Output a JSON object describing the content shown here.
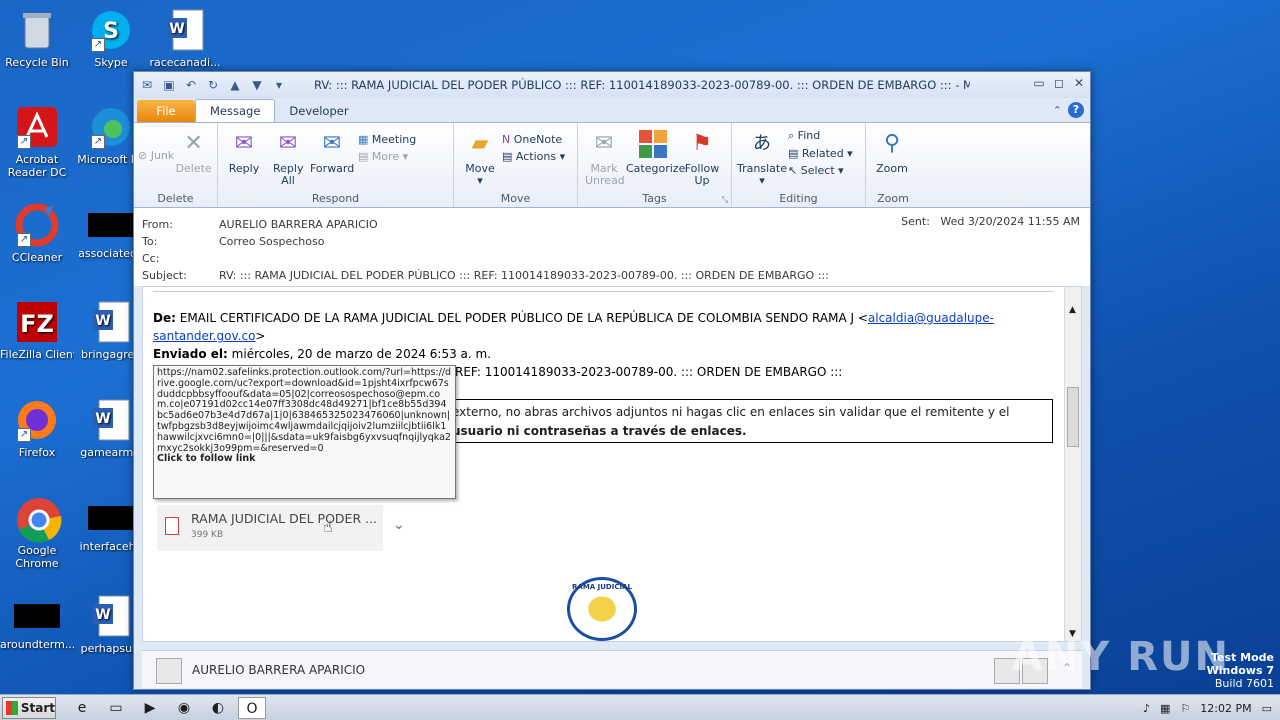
{
  "desktop": {
    "icons": [
      {
        "label": "Recycle Bin",
        "icon": "recycle-bin-icon"
      },
      {
        "label": "Skype",
        "icon": "skype-icon"
      },
      {
        "label": "racecanadi...",
        "icon": "word-doc-icon"
      },
      {
        "label": "Acrobat Reader DC",
        "icon": "acrobat-icon"
      },
      {
        "label": "Microsoft Ed",
        "icon": "edge-icon"
      },
      {
        "label": "CCleaner",
        "icon": "ccleaner-icon"
      },
      {
        "label": "associatede",
        "icon": "black-file-icon"
      },
      {
        "label": "FileZilla Client",
        "icon": "filezilla-icon"
      },
      {
        "label": "bringagree",
        "icon": "word-doc-icon"
      },
      {
        "label": "Firefox",
        "icon": "firefox-icon"
      },
      {
        "label": "gamearmy.",
        "icon": "word-doc-icon"
      },
      {
        "label": "Google Chrome",
        "icon": "chrome-icon"
      },
      {
        "label": "interfaceha",
        "icon": "black-file-icon"
      },
      {
        "label": "aroundterm...",
        "icon": "black-file-icon"
      },
      {
        "label": "perhapsus.",
        "icon": "word-doc-icon"
      }
    ]
  },
  "window": {
    "title": "RV: ::: RAMA JUDICIAL DEL PODER PÚBLICO ::: REF: 110014189033-2023-00789-00. ::: ORDEN DE EMBARGO ::: -  Message (HTML)",
    "tabs": {
      "file": "File",
      "message": "Message",
      "developer": "Developer"
    }
  },
  "ribbon": {
    "delete_group": {
      "name": "Delete",
      "junk": "Junk",
      "delete": "Delete"
    },
    "respond_group": {
      "name": "Respond",
      "reply": "Reply",
      "reply_all": "Reply All",
      "forward": "Forward",
      "meeting": "Meeting",
      "more": "More"
    },
    "move_group": {
      "name": "Move",
      "move": "Move",
      "onenote": "OneNote",
      "actions": "Actions"
    },
    "tags_group": {
      "name": "Tags",
      "mark_unread": "Mark Unread",
      "categorize": "Categorize",
      "follow_up": "Follow Up"
    },
    "editing_group": {
      "name": "Editing",
      "translate": "Translate",
      "find": "Find",
      "related": "Related",
      "select": "Select"
    },
    "zoom_group": {
      "name": "Zoom",
      "zoom": "Zoom"
    }
  },
  "header": {
    "from_label": "From:",
    "from_value": "AURELIO  BARRERA APARICIO",
    "to_label": "To:",
    "to_value": "Correo Sospechoso",
    "cc_label": "Cc:",
    "subject_label": "Subject:",
    "subject_value": "RV: ::: RAMA JUDICIAL DEL PODER PÚBLICO ::: REF: 110014189033-2023-00789-00. ::: ORDEN DE EMBARGO :::",
    "sent_label": "Sent:",
    "sent_value": "Wed 3/20/2024 11:55 AM"
  },
  "body": {
    "de_label": "De:",
    "de_value": "EMAIL CERTIFICADO DE LA RAMA JUDICIAL DEL PODER PÚBLICO DE LA REPÚBLICA DE COLOMBIA SENDO RAMA J <",
    "de_email": "alcaldia@guadalupe-santander.gov.co",
    "de_close": ">",
    "enviado_label": "Enviado el:",
    "enviado_value": "miércoles, 20 de marzo de 2024 6:53 a. m.",
    "asunto_tail": "REF: 110014189033-2023-00789-00. ::: ORDEN DE EMBARGO :::",
    "warning_line1": "externo, no abras archivos adjuntos ni hagas clic en enlaces sin validar que el remitente y el",
    "warning_line2": "usuario ni contraseñas a través de enlaces.",
    "tooltip_url": "https://nam02.safelinks.protection.outlook.com/?url=https://drive.google.com/uc?export=download&id=1pjsht4ixrfpcw67sduddcpbbsyffoouf&data=05|02|correosospechoso@epm.com.co|e07191d02cc14e07ff3308dc48d49271|bf1ce8b55d394bc5ad6e07b3e4d7d67a|1|0|638465325023476060|unknown|twfpbgzsb3d8eyjwijoimc4wljawmdailcjqijoiv2lumziilcjbtii6lk1hawwilcjxvci6mn0=|0|||&sdata=uk9faisbg6yxvsuqfnqijlyqka2mxyc2sokkj3o99pm=&reserved=0",
    "tooltip_click": "Click to follow link",
    "attachment_name": "RAMA JUDICIAL DEL PODER ...",
    "attachment_size": "399 KB",
    "seal_text": "RAMA JUDICIAL"
  },
  "people_pane": {
    "name": "AURELIO  BARRERA APARICIO"
  },
  "taskbar": {
    "start": "Start",
    "time": "12:02 PM"
  },
  "watermark": {
    "line1": "Test Mode",
    "line2": "Windows 7",
    "line3": "Build 7601",
    "brand": "ANY RUN"
  }
}
